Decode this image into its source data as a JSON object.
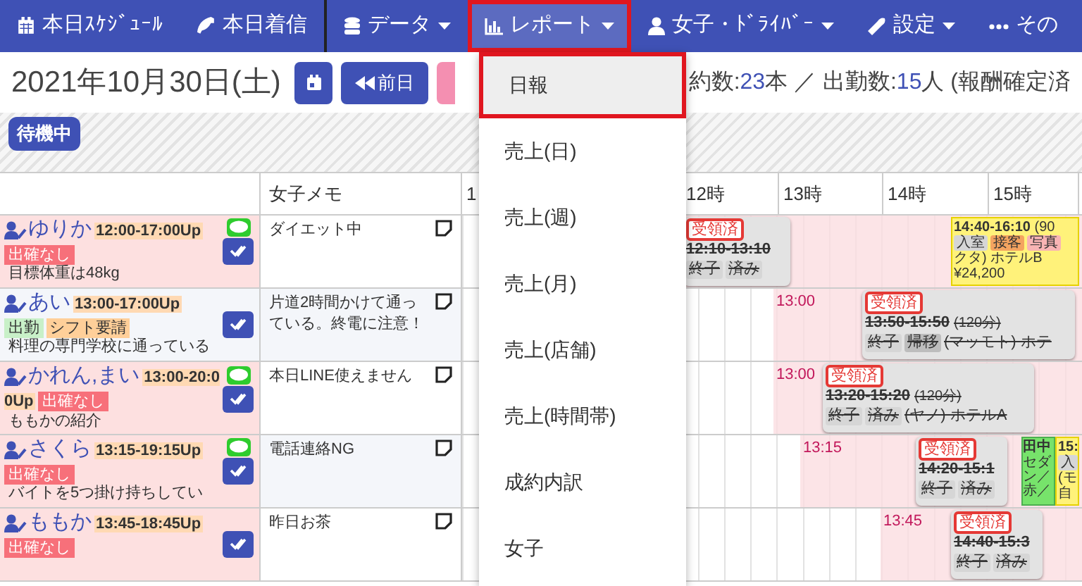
{
  "nav": [
    {
      "kind": "calendar",
      "label": "本日ｽｹｼﾞｭｰﾙ",
      "dropdown": false,
      "selected": false
    },
    {
      "kind": "phone",
      "label": "本日着信",
      "dropdown": false,
      "selected": false
    },
    {
      "kind": "database",
      "label": "データ",
      "dropdown": true,
      "selected": false
    },
    {
      "kind": "chart",
      "label": "レポート",
      "dropdown": true,
      "selected": true
    },
    {
      "kind": "person",
      "label": "女子・ﾄﾞﾗｲﾊﾞｰ",
      "dropdown": true,
      "selected": false
    },
    {
      "kind": "wrench",
      "label": "設定",
      "dropdown": true,
      "selected": false
    },
    {
      "kind": "dots",
      "label": "その",
      "dropdown": false,
      "selected": false
    }
  ],
  "report_menu": [
    {
      "label": "日報",
      "selected": true
    },
    {
      "label": "売上(日)",
      "selected": false
    },
    {
      "label": "売上(週)",
      "selected": false
    },
    {
      "label": "売上(月)",
      "selected": false
    },
    {
      "label": "売上(店舗)",
      "selected": false
    },
    {
      "label": "売上(時間帯)",
      "selected": false
    },
    {
      "label": "成約内訳",
      "selected": false
    },
    {
      "label": "女子",
      "selected": false
    }
  ],
  "date": "2021年10月30日(土)",
  "prev_button": "前日",
  "summary": [
    {
      "kind": "text",
      "text": "約数:"
    },
    {
      "kind": "count",
      "text": "23"
    },
    {
      "kind": "text",
      "text": "本 ／ 出勤数:"
    },
    {
      "kind": "count",
      "text": "15"
    },
    {
      "kind": "text",
      "text": "人 (報酬確定済"
    }
  ],
  "waiting_label": "待機中",
  "table": {
    "memo_header": "女子メモ",
    "hours": [
      "1",
      "12時",
      "13時",
      "14時",
      "15時"
    ],
    "rows": [
      {
        "name": "ゆりか",
        "shift": "12:00-17:00Up",
        "tags": [
          {
            "kind": "alert",
            "text": "出確なし"
          }
        ],
        "note": "目標体重は48kg",
        "chat": true,
        "unconfirmed": true,
        "memo": "ダイエット中",
        "bookings": [
          {
            "kind": "done",
            "badge": "受領済",
            "time": "12:10-13:10",
            "tags": [
              {
                "kind": "plain",
                "text": "終子"
              },
              {
                "kind": "plain",
                "text": "済み"
              }
            ]
          },
          {
            "kind": "active",
            "time": "14:40-16:10",
            "duration": "(90",
            "tags": [
              {
                "kind": "plain",
                "text": "入室"
              },
              {
                "kind": "orange",
                "text": "接客"
              },
              {
                "kind": "pink",
                "text": "写真"
              }
            ],
            "lines": [
              "クタ) ホテルB",
              "¥24,200"
            ]
          }
        ]
      },
      {
        "name": "あい",
        "shift": "13:00-17:00Up",
        "tags": [
          {
            "kind": "present",
            "text": "出勤"
          },
          {
            "kind": "request",
            "text": "シフト要請"
          }
        ],
        "note": "料理の専門学校に通っている",
        "chat": false,
        "unconfirmed": false,
        "memo": "片道2時間かけて通っている。終電に注意！",
        "shift_start": "13:00",
        "bookings": [
          {
            "kind": "done",
            "badge": "受領済",
            "time": "13:50-15:50",
            "duration": "(120分)",
            "tags": [
              {
                "kind": "plain",
                "text": "終子"
              },
              {
                "kind": "dark",
                "text": "帰移"
              }
            ],
            "location": "(マッモト) ホテ"
          }
        ]
      },
      {
        "name": "かれん,まい",
        "shift": "13:00-20:00Up",
        "tags": [
          {
            "kind": "alert",
            "text": "出確なし"
          }
        ],
        "note": "ももかの紹介",
        "chat": true,
        "unconfirmed": true,
        "memo": "本日LINE使えません",
        "shift_start": "13:00",
        "bookings": [
          {
            "kind": "done",
            "badge": "受領済",
            "time": "13:20-15:20",
            "duration": "(120分)",
            "tags": [
              {
                "kind": "plain",
                "text": "終子"
              },
              {
                "kind": "plain",
                "text": "済み"
              }
            ],
            "location": "(ヤノ) ホテルA"
          }
        ]
      },
      {
        "name": "さくら",
        "shift": "13:15-19:15Up",
        "tags": [
          {
            "kind": "alert",
            "text": "出確なし"
          }
        ],
        "note": "バイトを5つ掛け持ちしてい",
        "chat": true,
        "unconfirmed": true,
        "memo": "電話連絡NG",
        "shift_start": "13:15",
        "bookings": [
          {
            "kind": "done",
            "badge": "受領済",
            "time": "14:20-15:1",
            "tags": [
              {
                "kind": "plain",
                "text": "終子"
              },
              {
                "kind": "plain",
                "text": "済み"
              }
            ]
          },
          {
            "kind": "driver",
            "time": "田中",
            "lines": [
              "セダン／赤／"
            ]
          },
          {
            "kind": "active",
            "time": "15:",
            "tags": [
              {
                "kind": "plain",
                "text": "入"
              }
            ],
            "lines": [
              "(モ",
              "自"
            ]
          }
        ]
      },
      {
        "name": "ももか",
        "shift": "13:45-18:45Up",
        "tags": [
          {
            "kind": "alert",
            "text": "出確なし"
          }
        ],
        "chat": false,
        "unconfirmed": true,
        "memo": "昨日お茶",
        "shift_start": "13:45",
        "bookings": [
          {
            "kind": "done",
            "badge": "受領済",
            "time": "14:40-15:3",
            "tags": [
              {
                "kind": "plain",
                "text": "終子"
              },
              {
                "kind": "plain",
                "text": "済み"
              }
            ]
          }
        ]
      }
    ]
  }
}
